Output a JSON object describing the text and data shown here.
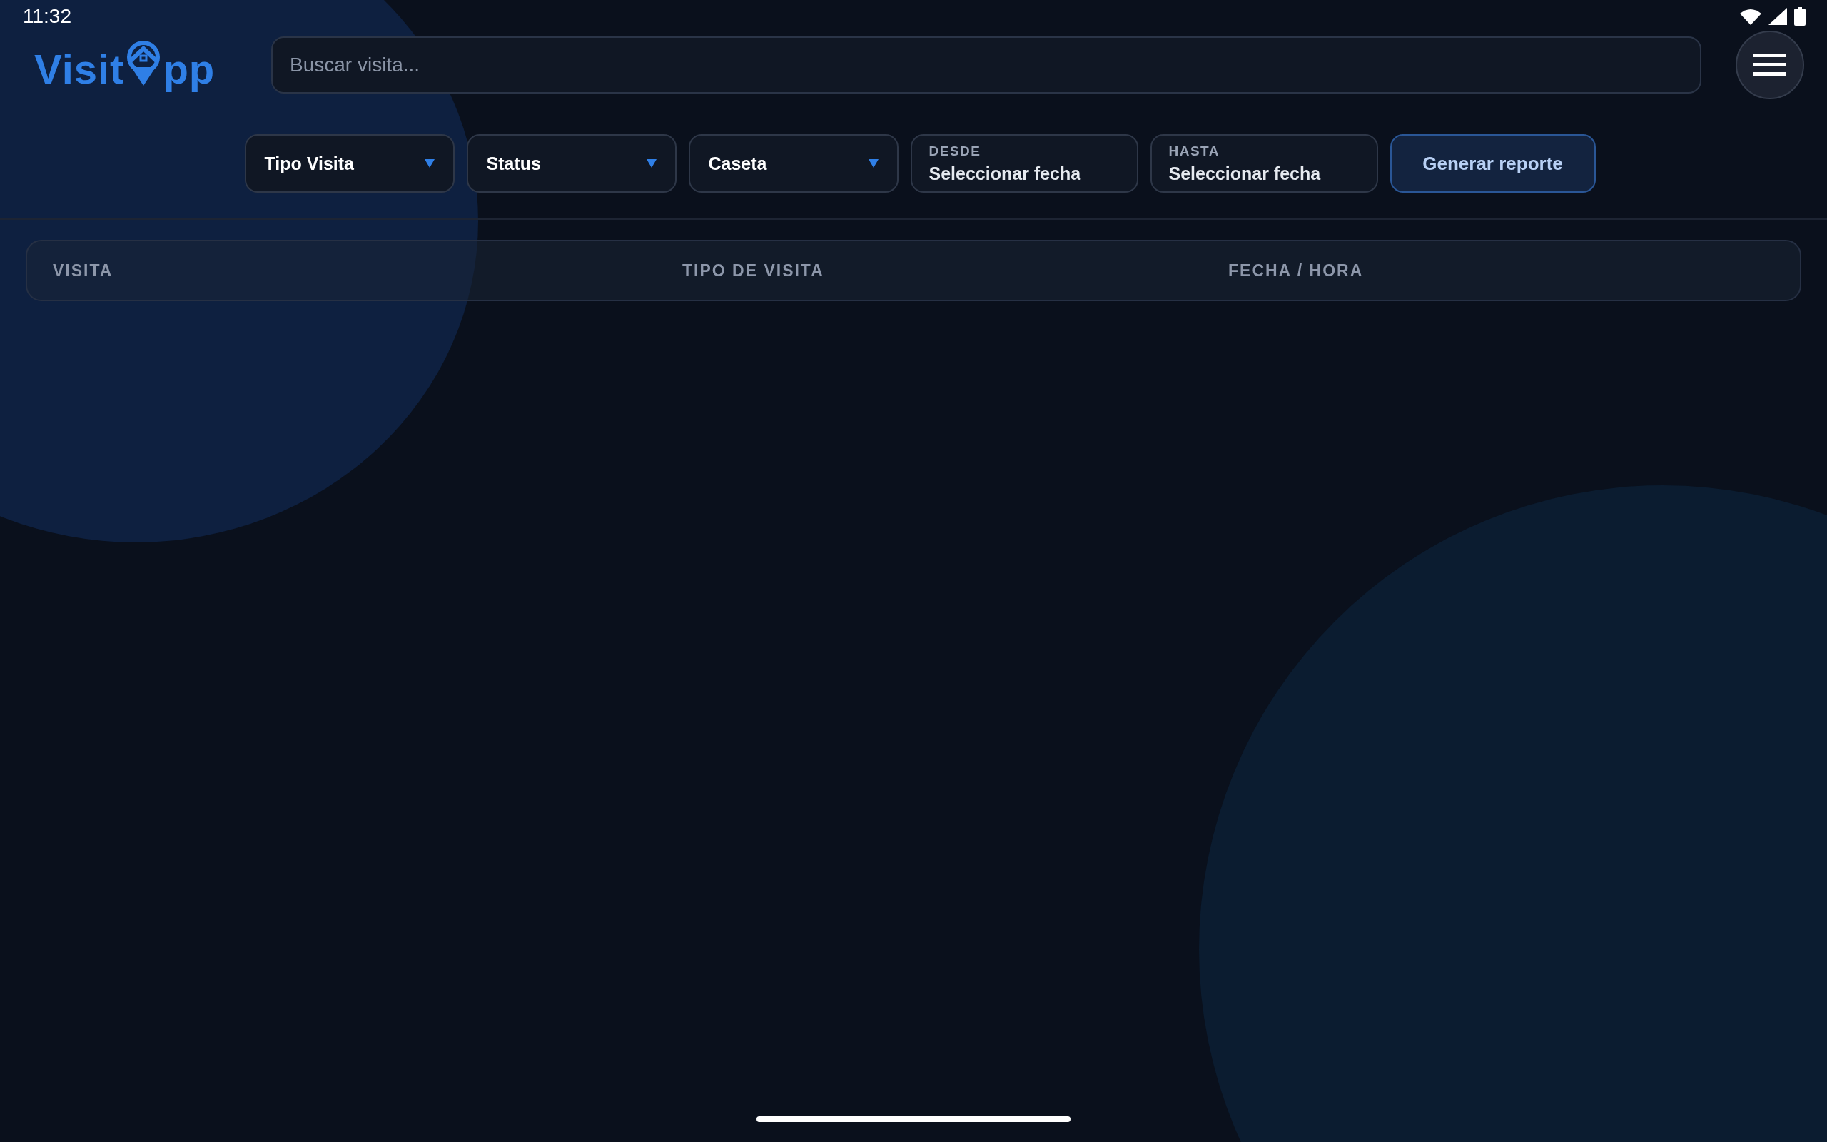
{
  "status_bar": {
    "time": "11:32"
  },
  "logo": {
    "part_1": "Visit",
    "part_2": "pp"
  },
  "search": {
    "placeholder": "Buscar visita..."
  },
  "filters": [
    {
      "kind": "dropdown",
      "label": "Tipo Visita"
    },
    {
      "kind": "dropdown",
      "label": "Status"
    },
    {
      "kind": "dropdown",
      "label": "Caseta"
    },
    {
      "kind": "date",
      "caption": "DESDE",
      "value": "Seleccionar fecha"
    },
    {
      "kind": "date",
      "caption": "HASTA",
      "value": "Seleccionar fecha"
    }
  ],
  "report_button": "Generar reporte",
  "table": {
    "columns": [
      "VISITA",
      "TIPO DE VISITA",
      "FECHA / HORA"
    ]
  }
}
